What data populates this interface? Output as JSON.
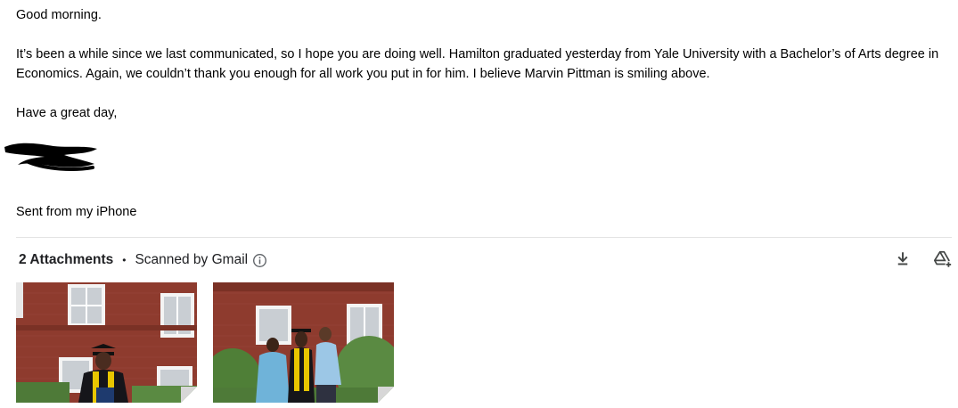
{
  "email": {
    "greeting": "Good morning.",
    "paragraph": "It’s been a while since we last communicated, so I hope you are doing well. Hamilton graduated yesterday from Yale University with a Bachelor’s of Arts degree in Economics. Again, we couldn’t thank you enough for all work you put in for him. I believe Marvin Pittman is smiling above.",
    "closing": "Have a great day,",
    "signoff": "Sent from my iPhone"
  },
  "attachments": {
    "count_label": "2 Attachments",
    "separator": "•",
    "scan_label": "Scanned by Gmail",
    "actions": [
      {
        "icon": "download-icon"
      },
      {
        "icon": "add-to-drive-icon"
      }
    ],
    "items": [
      {
        "icon": "photo-thumbnail"
      },
      {
        "icon": "photo-thumbnail"
      }
    ]
  },
  "colors": {
    "text": "#000000",
    "header_text": "#202124",
    "icon": "#444746",
    "divider": "#e3e3e3",
    "brick": "#8e3b2e"
  }
}
